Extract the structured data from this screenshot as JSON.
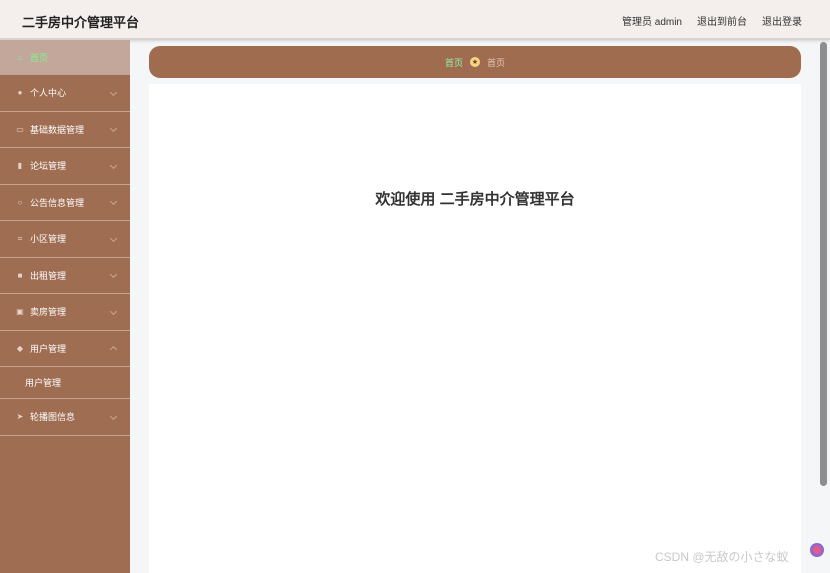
{
  "header": {
    "title": "二手房中介管理平台",
    "links": [
      "管理员 admin",
      "退出到前台",
      "退出登录"
    ]
  },
  "sidebar": {
    "items": [
      {
        "label": "首页",
        "icon": "home-icon",
        "active": true
      },
      {
        "label": "个人中心",
        "icon": "user-icon"
      },
      {
        "label": "基础数据管理",
        "icon": "data-icon"
      },
      {
        "label": "论坛管理",
        "icon": "chart-icon"
      },
      {
        "label": "公告信息管理",
        "icon": "power-icon"
      },
      {
        "label": "小区管理",
        "icon": "grid-icon"
      },
      {
        "label": "出租管理",
        "icon": "briefcase-icon"
      },
      {
        "label": "卖房管理",
        "icon": "clipboard-icon"
      },
      {
        "label": "用户管理",
        "icon": "shield-icon",
        "expanded": true
      },
      {
        "label": "轮播图信息",
        "icon": "send-icon"
      }
    ],
    "subitems": {
      "user_mgmt": "用户管理"
    }
  },
  "breadcrumb": {
    "home": "首页",
    "current": "首页"
  },
  "main": {
    "welcome": "欢迎使用 二手房中介管理平台"
  },
  "watermark": "CSDN @无敌の小さな蚁",
  "colors": {
    "sidebar": "#9f6d52",
    "active_text": "#7ef58e",
    "topbar": "#f4eeec"
  }
}
